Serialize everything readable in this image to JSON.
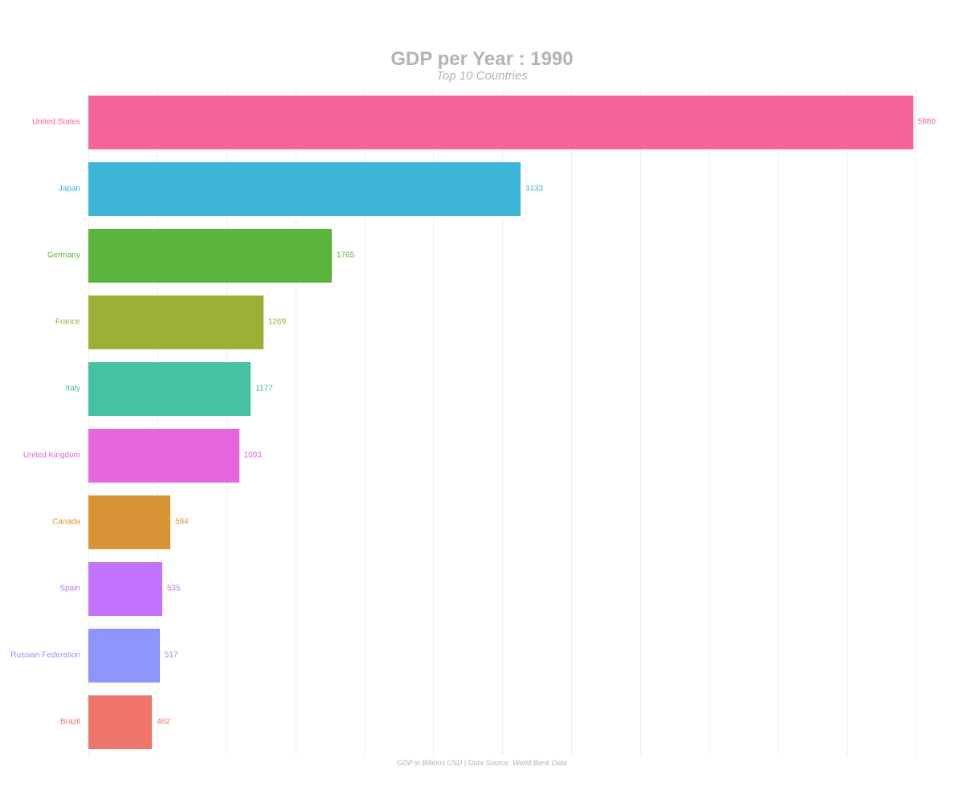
{
  "chart_data": {
    "type": "bar",
    "title": "GDP per Year : 1990",
    "subtitle": "Top 10 Countries",
    "footer": "GDP in Billions USD | Data Source: World Bank Data",
    "xlim": [
      0,
      6000
    ],
    "grid_step": 500,
    "categories": [
      "United States",
      "Japan",
      "Germany",
      "France",
      "Italy",
      "United Kingdom",
      "Canada",
      "Spain",
      "Russian Federation",
      "Brazil"
    ],
    "values": [
      5980,
      3133,
      1765,
      1269,
      1177,
      1093,
      594,
      535,
      517,
      462
    ],
    "colors": [
      "#f5649a",
      "#3db6d8",
      "#5cb43c",
      "#9ab036",
      "#44c2a2",
      "#e866dc",
      "#d89334",
      "#c173ff",
      "#8c95fa",
      "#ef746a"
    ]
  }
}
